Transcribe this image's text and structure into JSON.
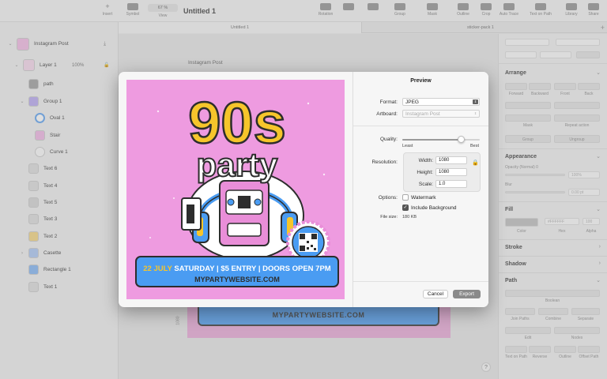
{
  "toolbar": {
    "document_title": "Untitled 1",
    "zoom": "67 %",
    "insert_label": "Insert",
    "items": [
      {
        "label": "Symbol"
      },
      {
        "label": "View"
      },
      {
        "label": "Rotation"
      },
      {
        "label": "Group"
      },
      {
        "label": "Mask"
      },
      {
        "label": "Outline"
      },
      {
        "label": "Crop"
      },
      {
        "label": "Auto Trace"
      },
      {
        "label": "Text on Path"
      },
      {
        "label": "Library"
      },
      {
        "label": "Share"
      }
    ]
  },
  "tabs": [
    {
      "label": "Untitled 1"
    },
    {
      "label": "sticker-pack 1"
    }
  ],
  "tab_add": "+",
  "layers": [
    {
      "name": "Instagram Post",
      "icon": "artboard-icon"
    },
    {
      "name": "Layer 1",
      "percent": "100%",
      "icon": "layer-icon"
    },
    {
      "name": "path",
      "icon": "path-icon"
    },
    {
      "name": "Group 1",
      "icon": "group-icon"
    },
    {
      "name": "Oval 1",
      "icon": "oval-icon"
    },
    {
      "name": "Stair",
      "icon": "stair-icon"
    },
    {
      "name": "Curve 1",
      "icon": "curve-icon"
    },
    {
      "name": "Text 6",
      "icon": "text-icon"
    },
    {
      "name": "Text 4",
      "icon": "text-icon"
    },
    {
      "name": "Text 5",
      "icon": "text-icon"
    },
    {
      "name": "Text 3",
      "icon": "text-icon"
    },
    {
      "name": "Text 2",
      "icon": "text-icon"
    },
    {
      "name": "Casette",
      "icon": "casette-icon"
    },
    {
      "name": "Rectangle 1",
      "icon": "rectangle-icon"
    },
    {
      "name": "Text 1",
      "icon": "text-icon"
    }
  ],
  "canvas": {
    "artboard_label": "Instagram Post",
    "behind_site": "MYPARTYWEBSITE.COM",
    "ruler_tick": "1080",
    "help": "?"
  },
  "inspector": {
    "arrange": "Arrange",
    "arrange_labels": [
      "Forward",
      "Backward",
      "Front",
      "Back"
    ],
    "mask": "Mask",
    "repeat_action": "Repeat action",
    "group": "Group",
    "ungroup": "Ungroup",
    "appearance": "Appearance",
    "opacity": "Opacity (Normal) 0",
    "opacity_val": "100%",
    "blur": "Blur",
    "blur_val": "0.00 pt",
    "fill": "Fill",
    "fill_color": "Color",
    "fill_hex_label": "Hex",
    "fill_alpha_label": "Alpha",
    "fill_hex": "#FFFFFF",
    "fill_alpha": "100",
    "stroke": "Stroke",
    "shadow": "Shadow",
    "path": "Path",
    "boolean": "Boolean",
    "path_labels": [
      "Join Paths",
      "Combine",
      "Separate",
      "Edit",
      "Nodes"
    ],
    "path_labels2": [
      "Text on Path",
      "Reverse",
      "Outline",
      "Offset Path"
    ]
  },
  "dialog": {
    "title": "Preview",
    "format_label": "Format:",
    "format_value": "JPEG",
    "artboard_label": "Artboard:",
    "artboard_value": "Instagram Post",
    "quality_label": "Quality:",
    "quality_level": 0.76,
    "quality_min": "Least",
    "quality_max": "Best",
    "resolution_label": "Resolution:",
    "width_label": "Width:",
    "width_value": "1080",
    "height_label": "Height:",
    "height_value": "1080",
    "scale_label": "Scale:",
    "scale_value": "1.0",
    "options_label": "Options:",
    "watermark_label": "Watermark",
    "watermark_checked": false,
    "include_bg_label": "Include Background",
    "include_bg_checked": true,
    "filesize_label": "File size:",
    "filesize_value": "180 KB",
    "cancel": "Cancel",
    "export": "Export"
  },
  "poster": {
    "headline": "90s",
    "subhead": "party",
    "banner_date": "22 JULY",
    "banner_rest": " SATURDAY | $5 ENTRY | DOORS OPEN 7PM",
    "banner_site": "MYPARTYWEBSITE.COM",
    "colors": {
      "bg": "#EE9BE0",
      "yellow": "#F6C52B",
      "blue": "#4A9CF2",
      "dark": "#2D2D2D",
      "pink": "#E98ED8"
    }
  },
  "colors": {
    "accent_gray": "#8A8A8A",
    "overlay": "rgba(160,160,160,0.34)"
  }
}
